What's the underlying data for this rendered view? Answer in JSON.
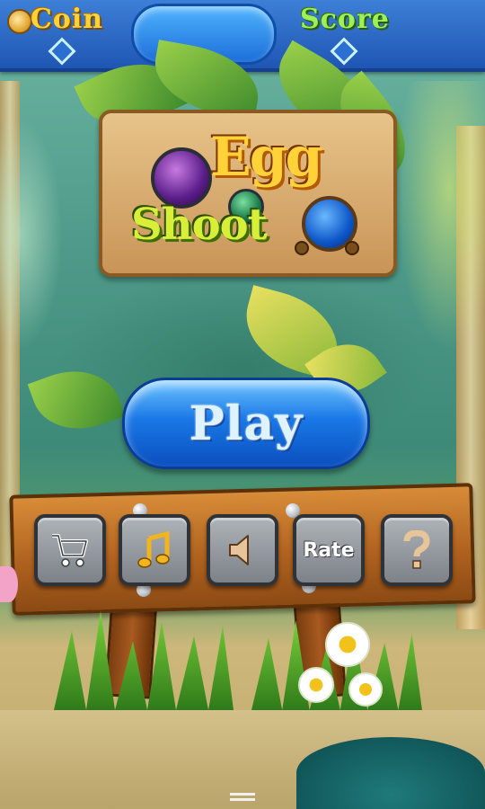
{
  "hud": {
    "coin_label": "Coin",
    "score_label": "Score",
    "center_display": ""
  },
  "logo": {
    "line1": "Egg",
    "line2": "Shoot"
  },
  "play_button": {
    "label": "Play"
  },
  "menu": {
    "items": [
      {
        "name": "shop",
        "icon": "cart-icon",
        "label": ""
      },
      {
        "name": "music",
        "icon": "music-note-icon",
        "label": ""
      },
      {
        "name": "sound",
        "icon": "speaker-icon",
        "label": ""
      },
      {
        "name": "rate",
        "icon": "",
        "label": "Rate"
      },
      {
        "name": "help",
        "icon": "question-mark-icon",
        "label": ""
      }
    ]
  },
  "colors": {
    "hud_blue": "#1f56b4",
    "coin_gold": "#ffd23a",
    "score_green": "#9ef05a",
    "play_blue": "#1a78e6",
    "wood": "#b0631f",
    "stone": "#7d8288"
  }
}
